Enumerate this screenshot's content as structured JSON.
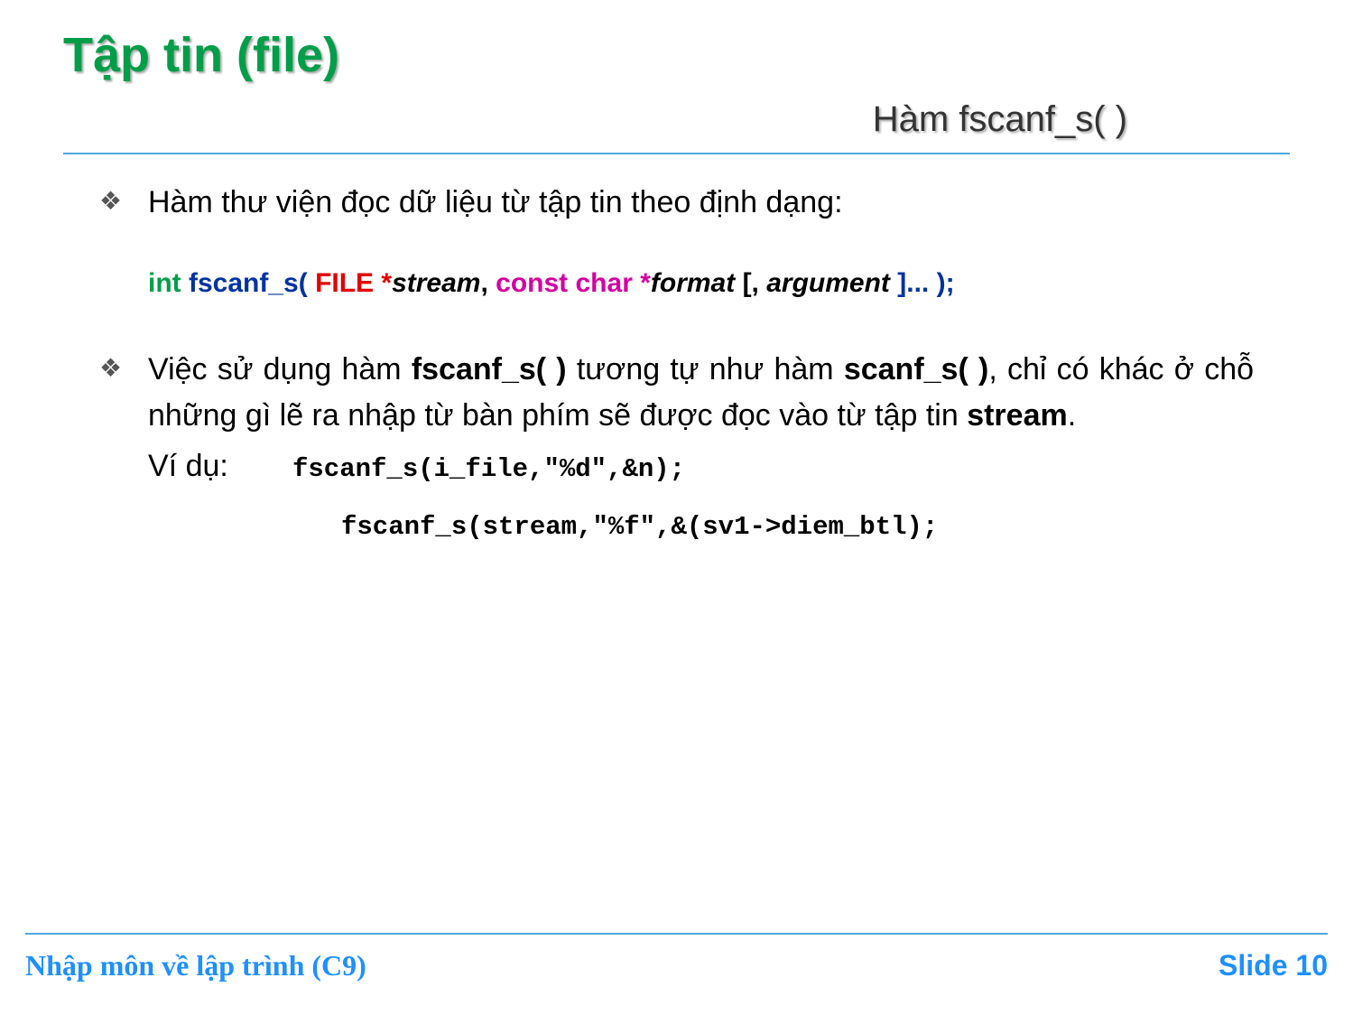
{
  "title": "Tập tin (file)",
  "subtitle": "Hàm fscanf_s( )",
  "bullets": {
    "b1": {
      "marker": "❖",
      "text": "Hàm thư viện đọc dữ liệu từ tập tin theo định dạng:"
    },
    "b2": {
      "marker": "❖",
      "p1": "Việc sử dụng hàm ",
      "fn1": "fscanf_s( )",
      "p2": " tương tự như hàm ",
      "fn2": "scanf_s( )",
      "p3": ", chỉ có khác ở chỗ những gì lẽ ra nhập từ bàn phím sẽ được đọc vào từ tập tin ",
      "stream": "stream",
      "p4": "."
    }
  },
  "signature": {
    "ret": "int ",
    "name": "fscanf_s",
    "open": "( ",
    "file": "FILE *",
    "arg1": "stream",
    "comma1": ", ",
    "cchar": "const char *",
    "arg2": "format",
    "opt": " [, ",
    "arg3": "argument",
    "end": " ]... );"
  },
  "example": {
    "label": "Ví dụ:",
    "line1": "fscanf_s(i_file,\"%d\",&n);",
    "line2": "fscanf_s(stream,\"%f\",&(sv1->diem_btl);"
  },
  "footer": {
    "left": "Nhập môn về lập trình (C9)",
    "right_label": "Slide ",
    "right_num": "10"
  }
}
